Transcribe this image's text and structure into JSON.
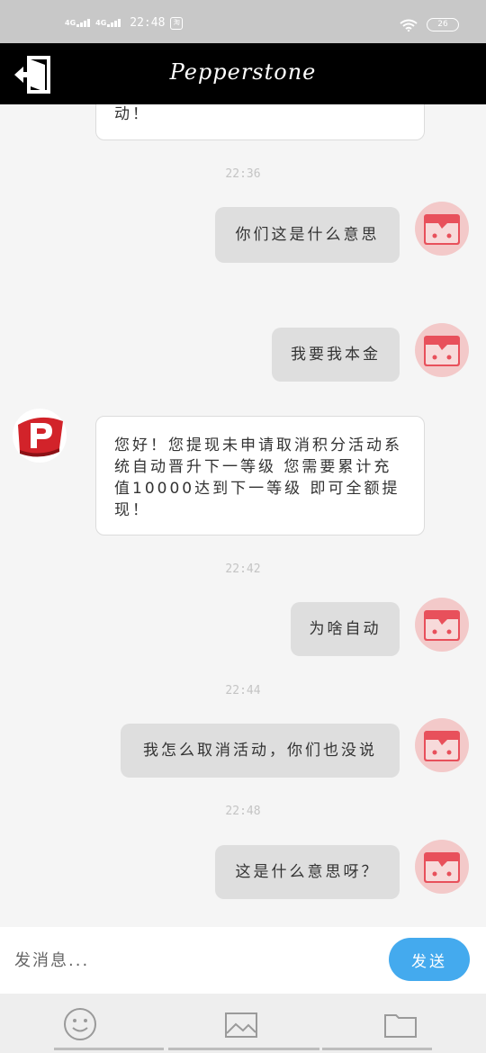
{
  "status_bar": {
    "network_1": "4G",
    "network_2": "4G",
    "time": "22:48",
    "notification": "淘",
    "battery": "26"
  },
  "header": {
    "title": "Pepperstone",
    "exit_icon": "exit-icon"
  },
  "messages": [
    {
      "from": "agent",
      "text": "动！"
    },
    {
      "type": "time",
      "text": "22:36"
    },
    {
      "from": "user",
      "text": "你们这是什么意思"
    },
    {
      "from": "user",
      "text": "我要我本金"
    },
    {
      "from": "agent",
      "text": "您好！您提现未申请取消积分活动系统自动晋升下一等级 您需要累计充值10000达到下一等级 即可全额提现！"
    },
    {
      "type": "time",
      "text": "22:42"
    },
    {
      "from": "user",
      "text": "为啥自动"
    },
    {
      "type": "time",
      "text": "22:44"
    },
    {
      "from": "user",
      "text": "我怎么取消活动，你们也没说"
    },
    {
      "type": "time",
      "text": "22:48"
    },
    {
      "from": "user",
      "text": "这是什么意思呀？"
    }
  ],
  "compose": {
    "placeholder": "发消息...",
    "send_label": "发送"
  },
  "toolbar": {
    "items": [
      "emoji-icon",
      "image-icon",
      "folder-icon"
    ]
  },
  "colors": {
    "header_bg": "#000000",
    "send_button": "#44aaee",
    "brand_red": "#d2232a",
    "user_avatar_bg": "#f3c9c9"
  }
}
